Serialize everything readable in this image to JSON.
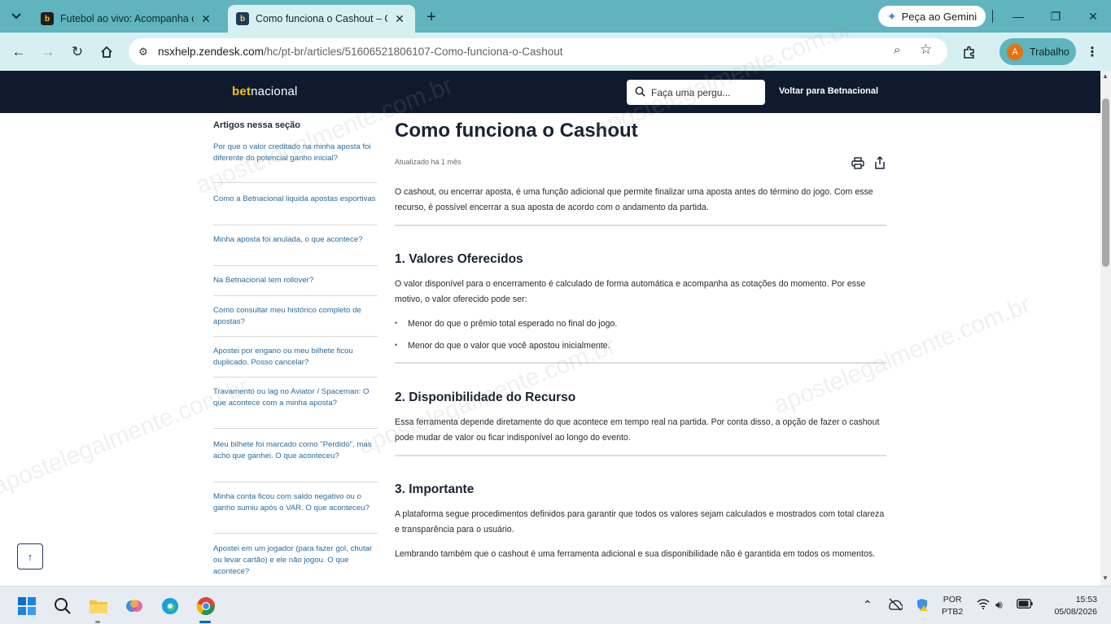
{
  "browser": {
    "tabs": [
      {
        "title": "Futebol ao vivo: Acompanha os"
      },
      {
        "title": "Como funciona o Cashout – Ce"
      }
    ],
    "gemini_label": "Peça ao Gemini",
    "url_host": "nsxhelp.zendesk.com",
    "url_path": "/hc/pt-br/articles/51606521806107-Como-funciona-o-Cashout",
    "profile_initial": "A",
    "profile_name": "Trabalho"
  },
  "site": {
    "logo_bet": "bet",
    "logo_nacional": "nacional",
    "search_placeholder": "Faça uma pergu...",
    "back_link": "Voltar para Betnacional"
  },
  "sidebar": {
    "title": "Artigos nessa seção",
    "items": [
      "Por que o valor creditado na minha aposta foi diferente do potencial ganho inicial?",
      "Como a Betnacional liquida apostas esportivas",
      "Minha aposta foi anulada, o que acontece?",
      "Na Betnacional tem rollover?",
      "Como consultar meu histórico completo de apostas?",
      "Apostei por engano ou meu bilhete ficou duplicado. Posso cancelar?",
      "Travamento ou lag no Aviator / Spaceman: O que acontece com a minha aposta?",
      "Meu bilhete foi marcado como \"Perdido\", mas acho que ganhei. O que aconteceu?",
      "Minha conta ficou com saldo negativo ou o ganho sumiu após o VAR. O que aconteceu?",
      "Apostei em um jogador (para fazer gol, chutar ou levar cartão) e ele não jogou. O que acontece?"
    ]
  },
  "article": {
    "title": "Como funciona o Cashout",
    "updated": "Atualizado há 1 mês",
    "intro": "O cashout, ou encerrar aposta, é uma função adicional que permite finalizar uma aposta antes do término do jogo. Com esse recurso, é possível encerrar a sua aposta de acordo com o andamento da partida.",
    "s1_title": "1. Valores Oferecidos",
    "s1_text": "O valor disponível para o encerramento é calculado de forma automática e acompanha as cotações do momento. Por esse motivo, o valor oferecido pode ser:",
    "s1_bullets": [
      "Menor do que o prêmio total esperado no final do jogo.",
      "Menor do que o valor que você apostou inicialmente."
    ],
    "s2_title": "2. Disponibilidade do Recurso",
    "s2_text": "Essa ferramenta depende diretamente do que acontece em tempo real na partida. Por conta disso, a opção de fazer o cashout pode mudar de valor ou ficar indisponível ao longo do evento.",
    "s3_title": "3. Importante",
    "s3_text1": "A plataforma segue procedimentos definidos para garantir que todos os valores sejam calculados e mostrados com total clareza e transparência para o usuário.",
    "s3_text2": "Lembrando também que o cashout é uma ferramenta adicional e sua disponibilidade não é garantida em todos os momentos."
  },
  "taskbar": {
    "lang_line1": "POR",
    "lang_line2": "PTB2",
    "time": "15:53",
    "date": "05/08/2026"
  },
  "watermark": "apostelegalmente.com.br",
  "colors": {
    "tabstrip": "#5fb4bd",
    "toolbar": "#d6f0f2",
    "site_header": "#0f1a2e",
    "brand_yellow": "#f5c400",
    "link": "#2a6a9e"
  }
}
